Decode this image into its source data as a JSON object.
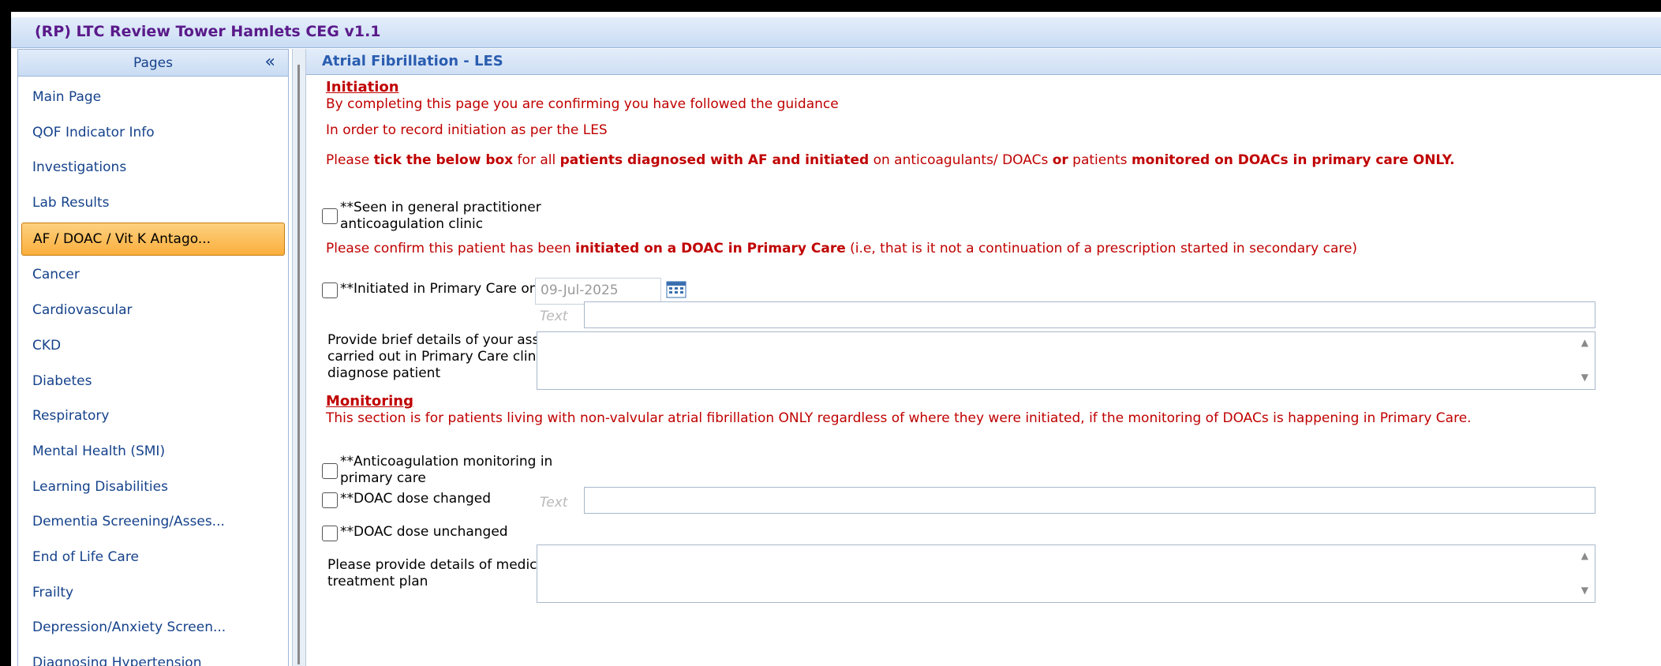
{
  "window": {
    "title": "(RP) LTC Review Tower Hamlets CEG v1.1"
  },
  "sidebar": {
    "title": "Pages",
    "collapse_glyph": "«",
    "items": [
      {
        "label": "Main Page"
      },
      {
        "label": "QOF Indicator Info"
      },
      {
        "label": "Investigations"
      },
      {
        "label": "Lab Results"
      },
      {
        "label": "AF / DOAC / Vit K Antago...",
        "active": true
      },
      {
        "label": "Cancer"
      },
      {
        "label": "Cardiovascular"
      },
      {
        "label": "CKD"
      },
      {
        "label": "Diabetes"
      },
      {
        "label": "Respiratory"
      },
      {
        "label": "Mental Health (SMI)"
      },
      {
        "label": "Learning Disabilities"
      },
      {
        "label": "Dementia Screening/Asses..."
      },
      {
        "label": "End of Life Care"
      },
      {
        "label": "Frailty"
      },
      {
        "label": "Depression/Anxiety Screen..."
      },
      {
        "label": "Diagnosing Hypertension"
      }
    ]
  },
  "main": {
    "title": "Atrial Fibrillation - LES",
    "initiation": {
      "heading": "Initiation ",
      "line1": "By completing this page you are confirming you have followed the guidance",
      "line2": "In order to record initiation as per the LES",
      "line3": [
        {
          "t": "Please ",
          "b": false
        },
        {
          "t": "tick the below box",
          "b": true
        },
        {
          "t": " for all ",
          "b": false
        },
        {
          "t": "patients diagnosed with AF and initiated",
          "b": true
        },
        {
          "t": " on anticoagulants/ DOACs ",
          "b": false
        },
        {
          "t": "or",
          "b": true
        },
        {
          "t": " patients ",
          "b": false
        },
        {
          "t": "monitored on DOACs in primary care ONLY.",
          "b": true
        }
      ],
      "seen_label_1": "**Seen in general practitioner",
      "seen_label_2": "anticoagulation clinic",
      "confirm": [
        {
          "t": "Please confirm this patient has been ",
          "b": false
        },
        {
          "t": "initiated on a DOAC in Primary Care",
          "b": true
        },
        {
          "t": " (i.e, that is it not a continuation of a prescription started in secondary care)",
          "b": false
        }
      ],
      "initiated_label": "**Initiated in Primary Care on DOAC",
      "initiated_date": "09-Jul-2025",
      "text_placeholder": "Text",
      "text_value": "",
      "assessment_label_1": "Provide brief details of your assessment",
      "assessment_label_2": "carried out in Primary Care clinic to",
      "assessment_label_3": "diagnose patient",
      "assessment_value": ""
    },
    "monitoring": {
      "heading": "Monitoring",
      "description": "This section is for patients living with non-valvular atrial fibrillation ONLY regardless of where they were initiated, if the monitoring of DOACs is happening in Primary Care.",
      "monitor_label_1": "**Anticoagulation monitoring in",
      "monitor_label_2": "primary care",
      "dose_changed_label": "**DOAC dose changed",
      "dose_changed_placeholder": "Text",
      "dose_changed_value": "",
      "dose_unchanged_label": "**DOAC dose unchanged",
      "plan_label_1": "Please provide details of medication",
      "plan_label_2": "treatment plan",
      "plan_value": ""
    }
  },
  "colors": {
    "accent": "#15428b",
    "warning_text": "#c00000",
    "active_item": "#fbae3c"
  },
  "icons": {
    "calendar": "calendar-icon",
    "scroll_up": "scroll-up-icon",
    "scroll_down": "scroll-down-icon"
  }
}
